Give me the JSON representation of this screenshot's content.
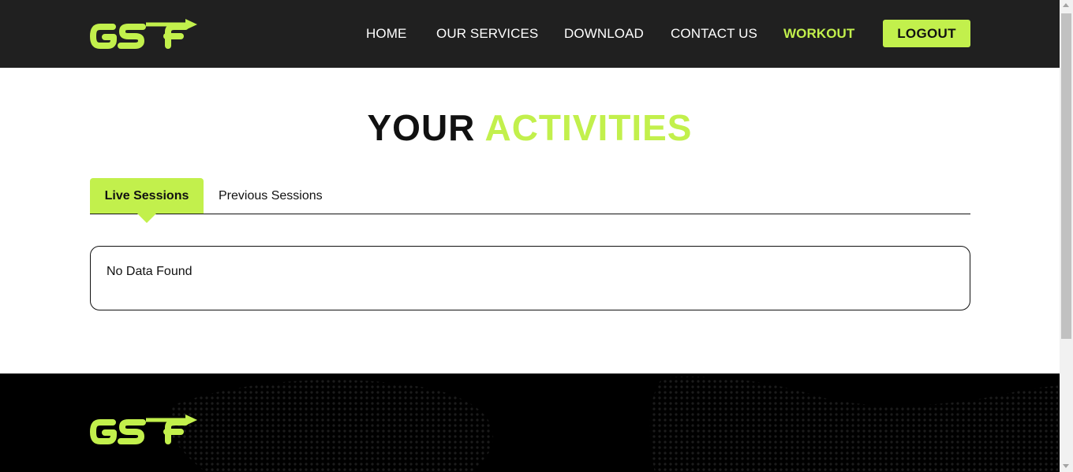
{
  "brand": {
    "logo_text": "GSF",
    "accent_color": "#c2f04c",
    "header_bg": "#202020",
    "footer_bg": "#000000"
  },
  "nav": {
    "items": [
      {
        "label": "HOME",
        "active": false
      },
      {
        "label": "OUR SERVICES",
        "active": false
      },
      {
        "label": "DOWNLOAD",
        "active": false
      },
      {
        "label": "CONTACT US",
        "active": false
      },
      {
        "label": "WORKOUT",
        "active": true
      }
    ],
    "logout_label": "LOGOUT"
  },
  "main": {
    "title_part1": "YOUR",
    "title_part2": "ACTIVITIES",
    "tabs": [
      {
        "label": "Live Sessions",
        "selected": true
      },
      {
        "label": "Previous Sessions",
        "selected": false
      }
    ],
    "empty_message": "No Data Found"
  },
  "icons": {
    "logo": "gsf-logo-icon",
    "tab_indicator": "caret-down-icon",
    "scroll_up": "scroll-up-arrow-icon",
    "scroll_down": "scroll-down-arrow-icon"
  }
}
